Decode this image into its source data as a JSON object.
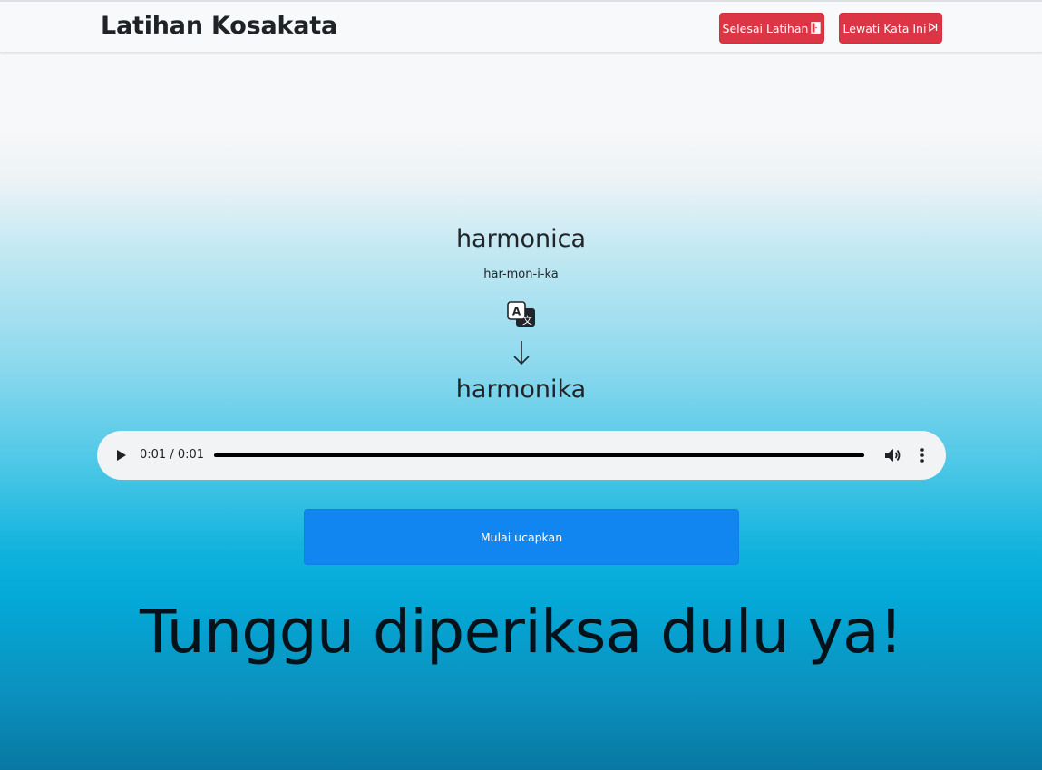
{
  "navbar": {
    "brand": "Latihan Kosakata",
    "finish_label": "Selesai Latihan",
    "skip_label": "Lewati Kata Ini"
  },
  "card": {
    "word_en": "harmonica",
    "syllables": "har-mon-i-ka",
    "translate_icon": "translate-icon",
    "arrow_icon": "arrow-down-icon",
    "word_id": "harmonika"
  },
  "audio": {
    "time": "0:01 / 0:01",
    "progress": 1.0
  },
  "speak_button_label": "Mulai ucapkan",
  "status_message": "Tunggu diperiksa dulu ya!",
  "colors": {
    "danger": "#dc3545",
    "primary": "#1186f0"
  }
}
